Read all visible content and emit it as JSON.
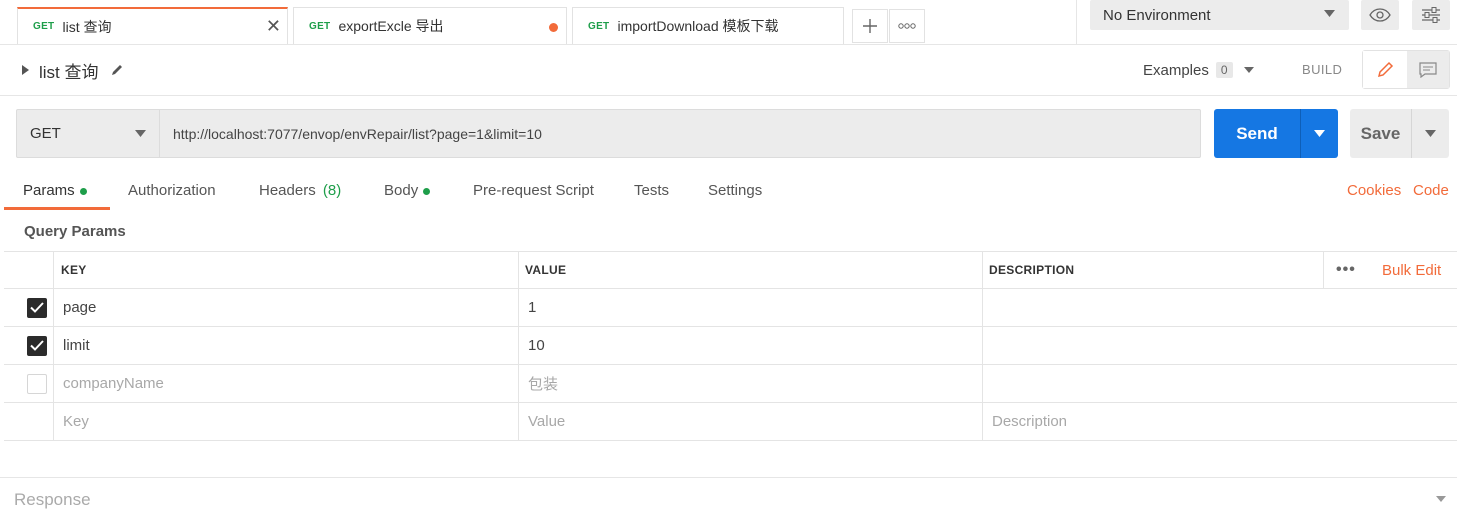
{
  "tabs": [
    {
      "method": "GET",
      "label": "list 查询",
      "active": true,
      "has_close": true
    },
    {
      "method": "GET",
      "label": "exportExcle 导出",
      "unsaved": true
    },
    {
      "method": "GET",
      "label": "importDownload 模板下载"
    }
  ],
  "environment": {
    "selected": "No Environment"
  },
  "request": {
    "name": "list 查询",
    "examples_label": "Examples",
    "examples_count": "0",
    "build_label": "BUILD",
    "method": "GET",
    "url": "http://localhost:7077/envop/envRepair/list?page=1&limit=10",
    "send_label": "Send",
    "save_label": "Save"
  },
  "subtabs": {
    "params": "Params",
    "authorization": "Authorization",
    "headers": "Headers",
    "headers_count": "(8)",
    "body": "Body",
    "prerequest": "Pre-request Script",
    "tests": "Tests",
    "settings": "Settings",
    "cookies": "Cookies",
    "code": "Code"
  },
  "query_params": {
    "section_title": "Query Params",
    "columns": {
      "key": "KEY",
      "value": "VALUE",
      "description": "DESCRIPTION"
    },
    "bulk_edit": "Bulk Edit",
    "rows": [
      {
        "checked": true,
        "key": "page",
        "value": "1",
        "description": ""
      },
      {
        "checked": true,
        "key": "limit",
        "value": "10",
        "description": ""
      },
      {
        "checked": false,
        "key": "companyName",
        "value": "包装",
        "description": ""
      }
    ],
    "placeholder": {
      "key": "Key",
      "value": "Value",
      "description": "Description"
    }
  },
  "response": {
    "label": "Response"
  },
  "colors": {
    "accent": "#f26b3a",
    "send_blue": "#1577e3",
    "method_green": "#1e9e4a"
  }
}
